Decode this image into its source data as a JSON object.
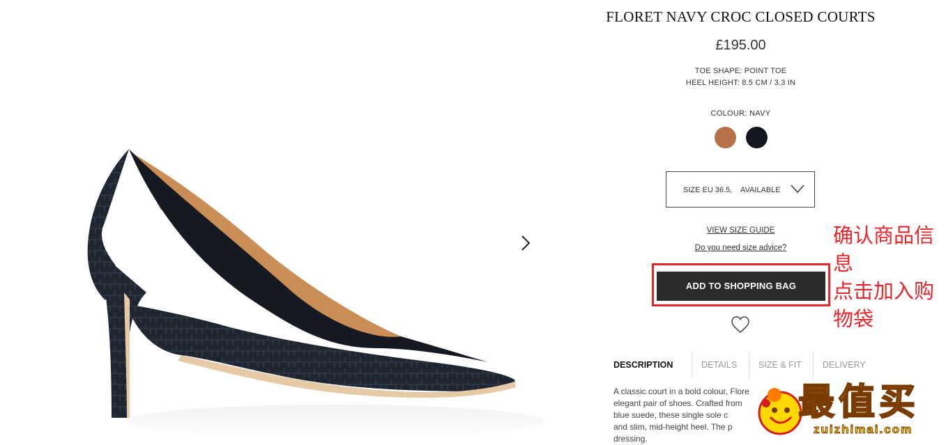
{
  "product": {
    "title": "FLORET NAVY CROC CLOSED COURTS",
    "price": "£195.00",
    "toe_shape": "TOE SHAPE: POINT TOE",
    "heel_height": "HEEL HEIGHT: 8.5 CM / 3.3 IN",
    "colour_label": "COLOUR:  NAVY",
    "swatches": [
      {
        "name": "tan",
        "color": "#b8724a"
      },
      {
        "name": "navy",
        "color": "#12161f"
      }
    ]
  },
  "size": {
    "selected": "SIZE EU 36.5,    AVAILABLE",
    "icon": "chevron-down-icon"
  },
  "links": {
    "size_guide": "VIEW SIZE GUIDE",
    "size_advice": "Do you need size advice?"
  },
  "actions": {
    "add_to_bag": "ADD TO SHOPPING BAG",
    "wishlist_icon": "heart-outline-icon",
    "next_image_icon": "chevron-right-icon"
  },
  "tabs": [
    {
      "label": "DESCRIPTION",
      "active": true
    },
    {
      "label": "DETAILS",
      "active": false
    },
    {
      "label": "SIZE & FIT",
      "active": false
    },
    {
      "label": "DELIVERY",
      "active": false
    }
  ],
  "description": {
    "lines": [
      "A classic court in a bold colour, Flore",
      "elegant pair of shoes. Crafted from",
      "blue suede, these single sole c",
      "and slim, mid-height heel. The p",
      "dressing."
    ]
  },
  "annotation": {
    "lines": [
      "确认商品信",
      "息",
      "点击加入购",
      "物袋"
    ],
    "color": "#e8262a"
  },
  "watermark": {
    "text": "最值买",
    "url": "zuizhimai.com"
  }
}
